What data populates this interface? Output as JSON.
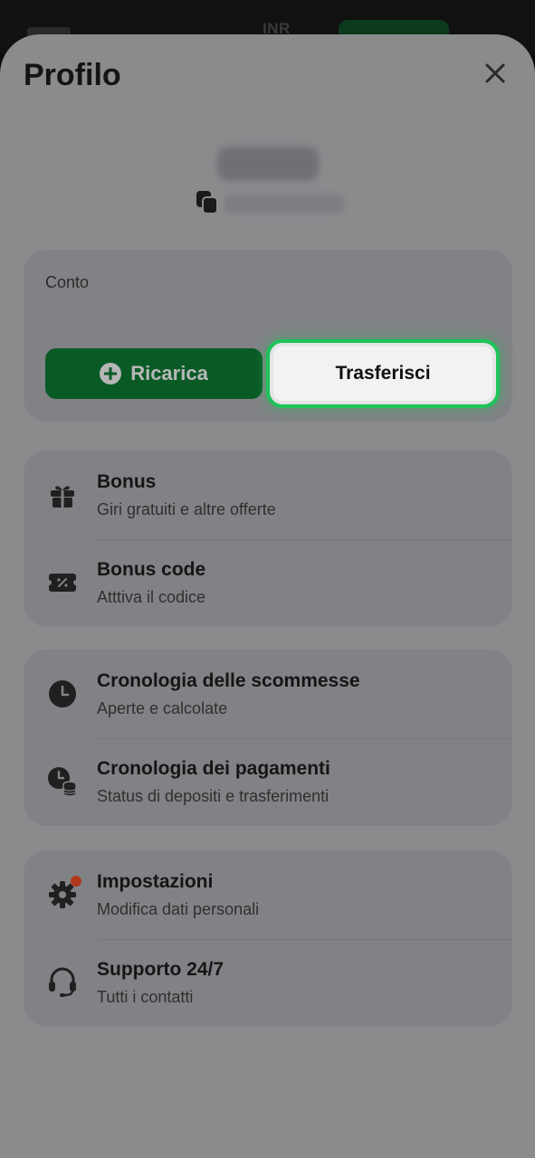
{
  "background": {
    "currency": "INR"
  },
  "header": {
    "title": "Profilo"
  },
  "account": {
    "label": "Conto",
    "deposit_button": "Ricarica",
    "transfer_button": "Trasferisci"
  },
  "menu": {
    "bonus": {
      "title": "Bonus",
      "subtitle": "Giri gratuiti e altre offerte",
      "icon": "gift-icon"
    },
    "bonus_code": {
      "title": "Bonus code",
      "subtitle": "Atttiva il codice",
      "icon": "coupon-icon"
    },
    "bet_history": {
      "title": "Cronologia delle scommesse",
      "subtitle": "Aperte e calcolate",
      "icon": "clock-icon"
    },
    "payment_history": {
      "title": "Cronologia dei pagamenti",
      "subtitle": "Status di depositi e trasferimenti",
      "icon": "clock-coins-icon"
    },
    "settings": {
      "title": "Impostazioni",
      "subtitle": "Modifica dati personali",
      "icon": "gear-icon"
    },
    "support": {
      "title": "Supporto 24/7",
      "subtitle": "Tutti i contatti",
      "icon": "headset-icon"
    }
  },
  "colors": {
    "sheet": "#8a8b8d",
    "card": "#818285",
    "deposit": "#0a5a26",
    "highlight": "#1fc35a",
    "notification_dot": "#b0371c"
  }
}
